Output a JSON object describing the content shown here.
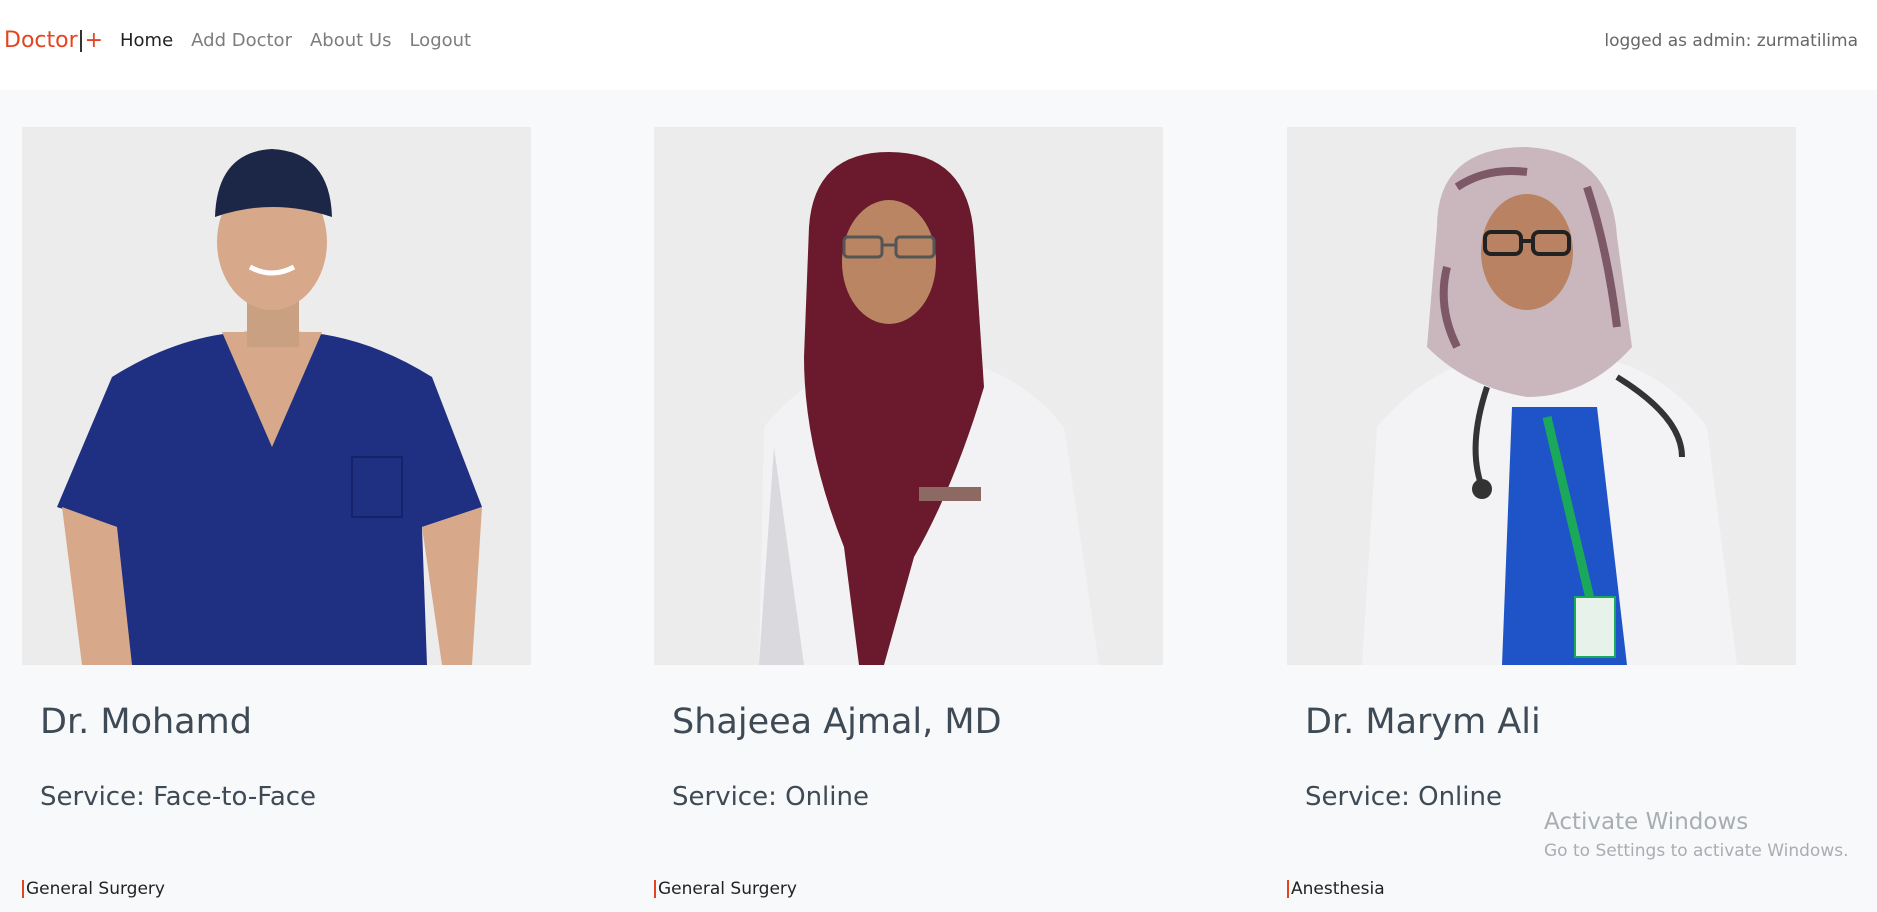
{
  "navbar": {
    "brand_text": "Doctor",
    "brand_plus": "+",
    "links": [
      {
        "label": "Home",
        "active": true
      },
      {
        "label": "Add Doctor",
        "active": false
      },
      {
        "label": "About Us",
        "active": false
      },
      {
        "label": "Logout",
        "active": false
      }
    ],
    "logged_text": "logged as admin: zurmatilima"
  },
  "doctors": [
    {
      "name": "Dr. Mohamd",
      "service": "Service: Face-to-Face",
      "specialty": "General Surgery",
      "photo_icon": "doctor-male-scrubs-photo"
    },
    {
      "name": "Shajeea Ajmal, MD",
      "service": "Service: Online",
      "specialty": "General Surgery",
      "photo_icon": "doctor-female-hijab-photo"
    },
    {
      "name": "Dr. Marym Ali",
      "service": "Service: Online",
      "specialty": "Anesthesia",
      "photo_icon": "doctor-female-stethoscope-photo"
    }
  ],
  "watermark": {
    "line1": "Activate Windows",
    "line2": "Go to Settings to activate Windows."
  },
  "colors": {
    "brand": "#e4441f",
    "heading": "#3e4a55",
    "page_bg": "#f8f9fa",
    "photo_bg": "#ececec"
  }
}
